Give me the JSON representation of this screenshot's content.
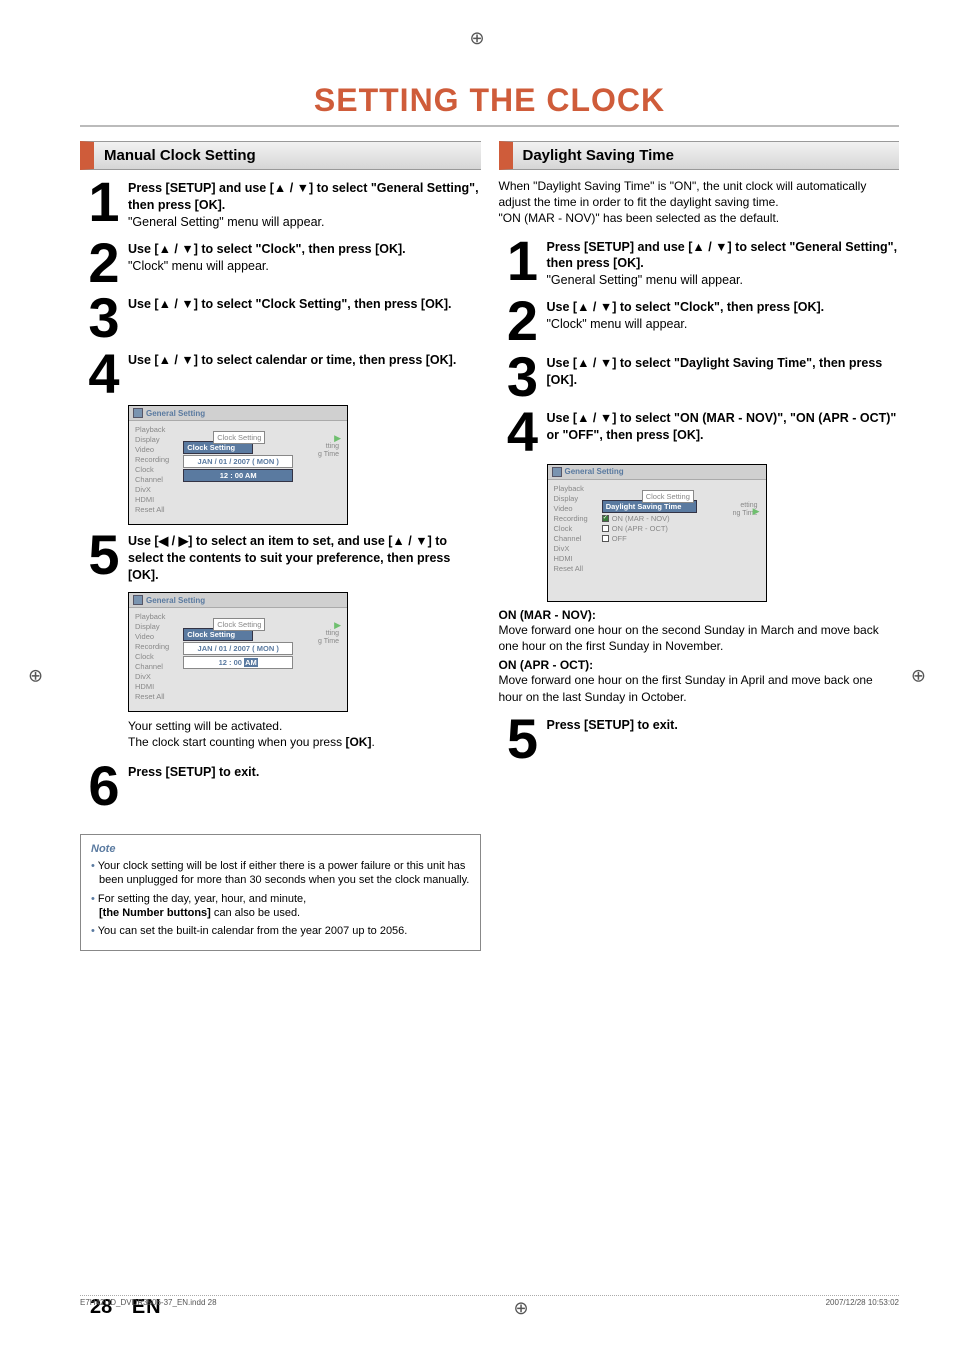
{
  "crop_glyph": "⊕",
  "title": "SETTING THE CLOCK",
  "left": {
    "header": "Manual Clock Setting",
    "steps": [
      {
        "num": "1",
        "bold": "Press [SETUP] and use [▲ / ▼] to select \"General Setting\", then press [OK].",
        "plain": "\"General Setting\" menu will appear."
      },
      {
        "num": "2",
        "bold": "Use [▲ / ▼] to select \"Clock\", then press [OK].",
        "plain": "\"Clock\" menu will appear."
      },
      {
        "num": "3",
        "bold": "Use [▲ / ▼] to select \"Clock Setting\", then press [OK].",
        "plain": ""
      },
      {
        "num": "4",
        "bold": "Use [▲ / ▼] to select calendar or time, then press [OK].",
        "plain": ""
      },
      {
        "num": "5",
        "bold": "Use [◀ / ▶] to select an item to set, and use [▲ / ▼] to select the contents to suit your preference, then press [OK].",
        "plain": ""
      },
      {
        "num": "6",
        "bold": "Press [SETUP] to exit.",
        "plain": ""
      }
    ],
    "step5_after1": "Your setting will be activated.",
    "step5_after2_a": "The clock start counting when you press ",
    "step5_after2_b": "[OK]",
    "step5_after2_c": ".",
    "menu": {
      "title": "General Setting",
      "items": [
        "Playback",
        "Display",
        "Video",
        "Recording",
        "Clock",
        "Channel",
        "DivX",
        "HDMI",
        "Reset All"
      ],
      "panel_label": "Clock Setting",
      "sub1": "tting",
      "sub2": "g Time",
      "sel": "Clock Setting",
      "date": "JAN / 01 / 2007 ( MON )",
      "time4": "12 : 00 AM",
      "time5_a": "12 : 00 ",
      "time5_b": "AM"
    },
    "note": {
      "title": "Note",
      "items": [
        "Your clock setting will be lost if either there is a power failure or this unit has been unplugged for more than 30 seconds when you set the clock manually.",
        {
          "a": "For setting the day, year, hour, and minute, ",
          "b": "[the Number buttons]",
          "c": " can also be used."
        },
        "You can set the built-in calendar from the year 2007 up to 2056."
      ]
    }
  },
  "right": {
    "header": "Daylight Saving Time",
    "intro1": "When \"Daylight Saving Time\" is \"ON\", the unit clock will automatically adjust the time in order to fit the daylight saving time.",
    "intro2": "\"ON (MAR - NOV)\" has been selected as the default.",
    "steps": [
      {
        "num": "1",
        "bold": "Press [SETUP] and use [▲ / ▼] to select \"General Setting\", then press [OK].",
        "plain": "\"General Setting\" menu will appear."
      },
      {
        "num": "2",
        "bold": "Use [▲ / ▼] to select \"Clock\", then press [OK].",
        "plain": "\"Clock\" menu will appear."
      },
      {
        "num": "3",
        "bold": "Use [▲ / ▼] to select \"Daylight Saving Time\", then press [OK].",
        "plain": ""
      },
      {
        "num": "4",
        "bold": "Use [▲ / ▼] to select \"ON (MAR - NOV)\", \"ON (APR - OCT)\" or \"OFF\", then press [OK].",
        "plain": ""
      },
      {
        "num": "5",
        "bold": "Press [SETUP] to exit.",
        "plain": ""
      }
    ],
    "menu": {
      "title": "General Setting",
      "items": [
        "Playback",
        "Display",
        "Video",
        "Recording",
        "Clock",
        "Channel",
        "DivX",
        "HDMI",
        "Reset All"
      ],
      "panel_label": "Clock Setting",
      "sub1": "etting",
      "sub2": "ng Time",
      "sel": "Daylight Saving Time",
      "opts": [
        "ON (MAR - NOV)",
        "ON (APR - OCT)",
        "OFF"
      ]
    },
    "explain": {
      "h1": "ON (MAR - NOV):",
      "p1": "Move forward one hour on the second Sunday in March and move back one hour on the first Sunday in November.",
      "h2": "ON (APR - OCT):",
      "p2": "Move forward one hour on the first Sunday in April and move back one hour on the last Sunday in October."
    }
  },
  "page_num": "28",
  "page_lang": "EN",
  "footer_left": "E7H42UD_DVDR3506-37_EN.indd   28",
  "footer_right": "2007/12/28   10:53:02"
}
